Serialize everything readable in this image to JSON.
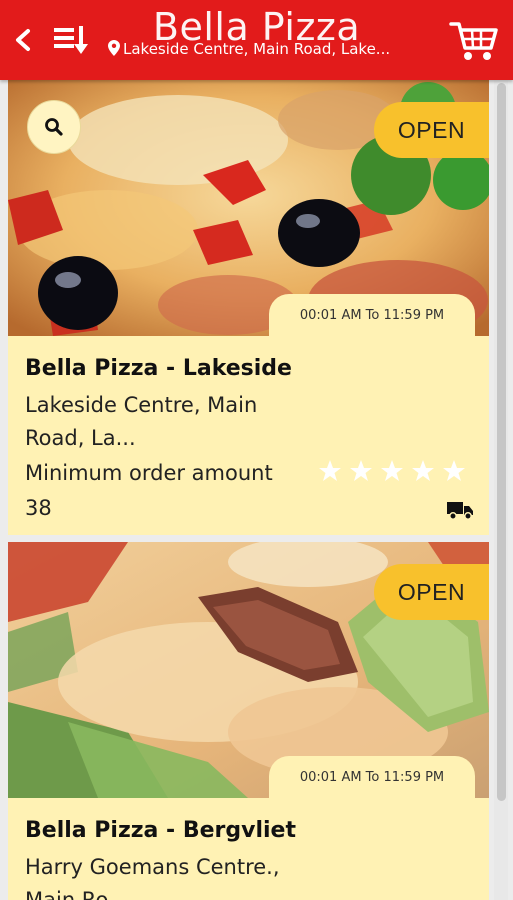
{
  "header": {
    "title": "Bella Pizza",
    "location": "Lakeside Centre, Main Road, Lake...",
    "icons": {
      "back": "chevron-left-icon",
      "sort": "sort-down-icon",
      "cart": "shopping-cart-icon",
      "location": "map-pin-icon"
    },
    "color": "#e21b1b"
  },
  "restaurants": [
    {
      "name": "Bella Pizza - Lakeside",
      "address_line1": "Lakeside Centre, Main",
      "address_line2": "Road, La...",
      "min_order_label": "Minimum order amount",
      "min_order_value": "38",
      "status": "OPEN",
      "hours": "00:01 AM To 11:59 PM",
      "rating": 0,
      "rating_max": 5
    },
    {
      "name": "Bella Pizza - Bergvliet",
      "address_line1": "Harry Goemans Centre.,",
      "address_line2": "Main Ro...",
      "status": "OPEN",
      "hours": "00:01 AM To 11:59 PM"
    }
  ],
  "colors": {
    "card_bg": "#fff2b4",
    "badge": "#f8c12c",
    "header": "#e21b1b"
  }
}
